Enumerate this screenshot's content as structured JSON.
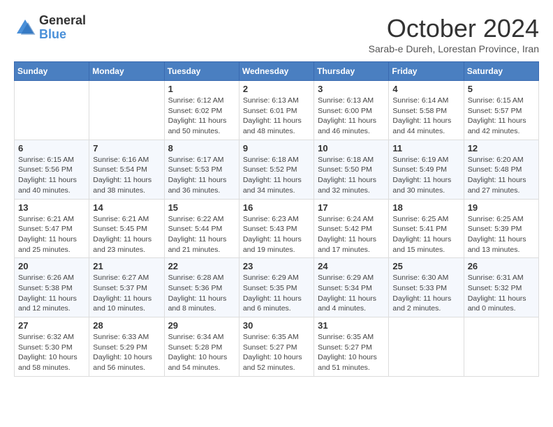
{
  "header": {
    "logo_line1": "General",
    "logo_line2": "Blue",
    "month_title": "October 2024",
    "subtitle": "Sarab-e Dureh, Lorestan Province, Iran"
  },
  "weekdays": [
    "Sunday",
    "Monday",
    "Tuesday",
    "Wednesday",
    "Thursday",
    "Friday",
    "Saturday"
  ],
  "weeks": [
    [
      {
        "day": "",
        "sunrise": "",
        "sunset": "",
        "daylight": ""
      },
      {
        "day": "",
        "sunrise": "",
        "sunset": "",
        "daylight": ""
      },
      {
        "day": "1",
        "sunrise": "Sunrise: 6:12 AM",
        "sunset": "Sunset: 6:02 PM",
        "daylight": "Daylight: 11 hours and 50 minutes."
      },
      {
        "day": "2",
        "sunrise": "Sunrise: 6:13 AM",
        "sunset": "Sunset: 6:01 PM",
        "daylight": "Daylight: 11 hours and 48 minutes."
      },
      {
        "day": "3",
        "sunrise": "Sunrise: 6:13 AM",
        "sunset": "Sunset: 6:00 PM",
        "daylight": "Daylight: 11 hours and 46 minutes."
      },
      {
        "day": "4",
        "sunrise": "Sunrise: 6:14 AM",
        "sunset": "Sunset: 5:58 PM",
        "daylight": "Daylight: 11 hours and 44 minutes."
      },
      {
        "day": "5",
        "sunrise": "Sunrise: 6:15 AM",
        "sunset": "Sunset: 5:57 PM",
        "daylight": "Daylight: 11 hours and 42 minutes."
      }
    ],
    [
      {
        "day": "6",
        "sunrise": "Sunrise: 6:15 AM",
        "sunset": "Sunset: 5:56 PM",
        "daylight": "Daylight: 11 hours and 40 minutes."
      },
      {
        "day": "7",
        "sunrise": "Sunrise: 6:16 AM",
        "sunset": "Sunset: 5:54 PM",
        "daylight": "Daylight: 11 hours and 38 minutes."
      },
      {
        "day": "8",
        "sunrise": "Sunrise: 6:17 AM",
        "sunset": "Sunset: 5:53 PM",
        "daylight": "Daylight: 11 hours and 36 minutes."
      },
      {
        "day": "9",
        "sunrise": "Sunrise: 6:18 AM",
        "sunset": "Sunset: 5:52 PM",
        "daylight": "Daylight: 11 hours and 34 minutes."
      },
      {
        "day": "10",
        "sunrise": "Sunrise: 6:18 AM",
        "sunset": "Sunset: 5:50 PM",
        "daylight": "Daylight: 11 hours and 32 minutes."
      },
      {
        "day": "11",
        "sunrise": "Sunrise: 6:19 AM",
        "sunset": "Sunset: 5:49 PM",
        "daylight": "Daylight: 11 hours and 30 minutes."
      },
      {
        "day": "12",
        "sunrise": "Sunrise: 6:20 AM",
        "sunset": "Sunset: 5:48 PM",
        "daylight": "Daylight: 11 hours and 27 minutes."
      }
    ],
    [
      {
        "day": "13",
        "sunrise": "Sunrise: 6:21 AM",
        "sunset": "Sunset: 5:47 PM",
        "daylight": "Daylight: 11 hours and 25 minutes."
      },
      {
        "day": "14",
        "sunrise": "Sunrise: 6:21 AM",
        "sunset": "Sunset: 5:45 PM",
        "daylight": "Daylight: 11 hours and 23 minutes."
      },
      {
        "day": "15",
        "sunrise": "Sunrise: 6:22 AM",
        "sunset": "Sunset: 5:44 PM",
        "daylight": "Daylight: 11 hours and 21 minutes."
      },
      {
        "day": "16",
        "sunrise": "Sunrise: 6:23 AM",
        "sunset": "Sunset: 5:43 PM",
        "daylight": "Daylight: 11 hours and 19 minutes."
      },
      {
        "day": "17",
        "sunrise": "Sunrise: 6:24 AM",
        "sunset": "Sunset: 5:42 PM",
        "daylight": "Daylight: 11 hours and 17 minutes."
      },
      {
        "day": "18",
        "sunrise": "Sunrise: 6:25 AM",
        "sunset": "Sunset: 5:41 PM",
        "daylight": "Daylight: 11 hours and 15 minutes."
      },
      {
        "day": "19",
        "sunrise": "Sunrise: 6:25 AM",
        "sunset": "Sunset: 5:39 PM",
        "daylight": "Daylight: 11 hours and 13 minutes."
      }
    ],
    [
      {
        "day": "20",
        "sunrise": "Sunrise: 6:26 AM",
        "sunset": "Sunset: 5:38 PM",
        "daylight": "Daylight: 11 hours and 12 minutes."
      },
      {
        "day": "21",
        "sunrise": "Sunrise: 6:27 AM",
        "sunset": "Sunset: 5:37 PM",
        "daylight": "Daylight: 11 hours and 10 minutes."
      },
      {
        "day": "22",
        "sunrise": "Sunrise: 6:28 AM",
        "sunset": "Sunset: 5:36 PM",
        "daylight": "Daylight: 11 hours and 8 minutes."
      },
      {
        "day": "23",
        "sunrise": "Sunrise: 6:29 AM",
        "sunset": "Sunset: 5:35 PM",
        "daylight": "Daylight: 11 hours and 6 minutes."
      },
      {
        "day": "24",
        "sunrise": "Sunrise: 6:29 AM",
        "sunset": "Sunset: 5:34 PM",
        "daylight": "Daylight: 11 hours and 4 minutes."
      },
      {
        "day": "25",
        "sunrise": "Sunrise: 6:30 AM",
        "sunset": "Sunset: 5:33 PM",
        "daylight": "Daylight: 11 hours and 2 minutes."
      },
      {
        "day": "26",
        "sunrise": "Sunrise: 6:31 AM",
        "sunset": "Sunset: 5:32 PM",
        "daylight": "Daylight: 11 hours and 0 minutes."
      }
    ],
    [
      {
        "day": "27",
        "sunrise": "Sunrise: 6:32 AM",
        "sunset": "Sunset: 5:30 PM",
        "daylight": "Daylight: 10 hours and 58 minutes."
      },
      {
        "day": "28",
        "sunrise": "Sunrise: 6:33 AM",
        "sunset": "Sunset: 5:29 PM",
        "daylight": "Daylight: 10 hours and 56 minutes."
      },
      {
        "day": "29",
        "sunrise": "Sunrise: 6:34 AM",
        "sunset": "Sunset: 5:28 PM",
        "daylight": "Daylight: 10 hours and 54 minutes."
      },
      {
        "day": "30",
        "sunrise": "Sunrise: 6:35 AM",
        "sunset": "Sunset: 5:27 PM",
        "daylight": "Daylight: 10 hours and 52 minutes."
      },
      {
        "day": "31",
        "sunrise": "Sunrise: 6:35 AM",
        "sunset": "Sunset: 5:27 PM",
        "daylight": "Daylight: 10 hours and 51 minutes."
      },
      {
        "day": "",
        "sunrise": "",
        "sunset": "",
        "daylight": ""
      },
      {
        "day": "",
        "sunrise": "",
        "sunset": "",
        "daylight": ""
      }
    ]
  ]
}
